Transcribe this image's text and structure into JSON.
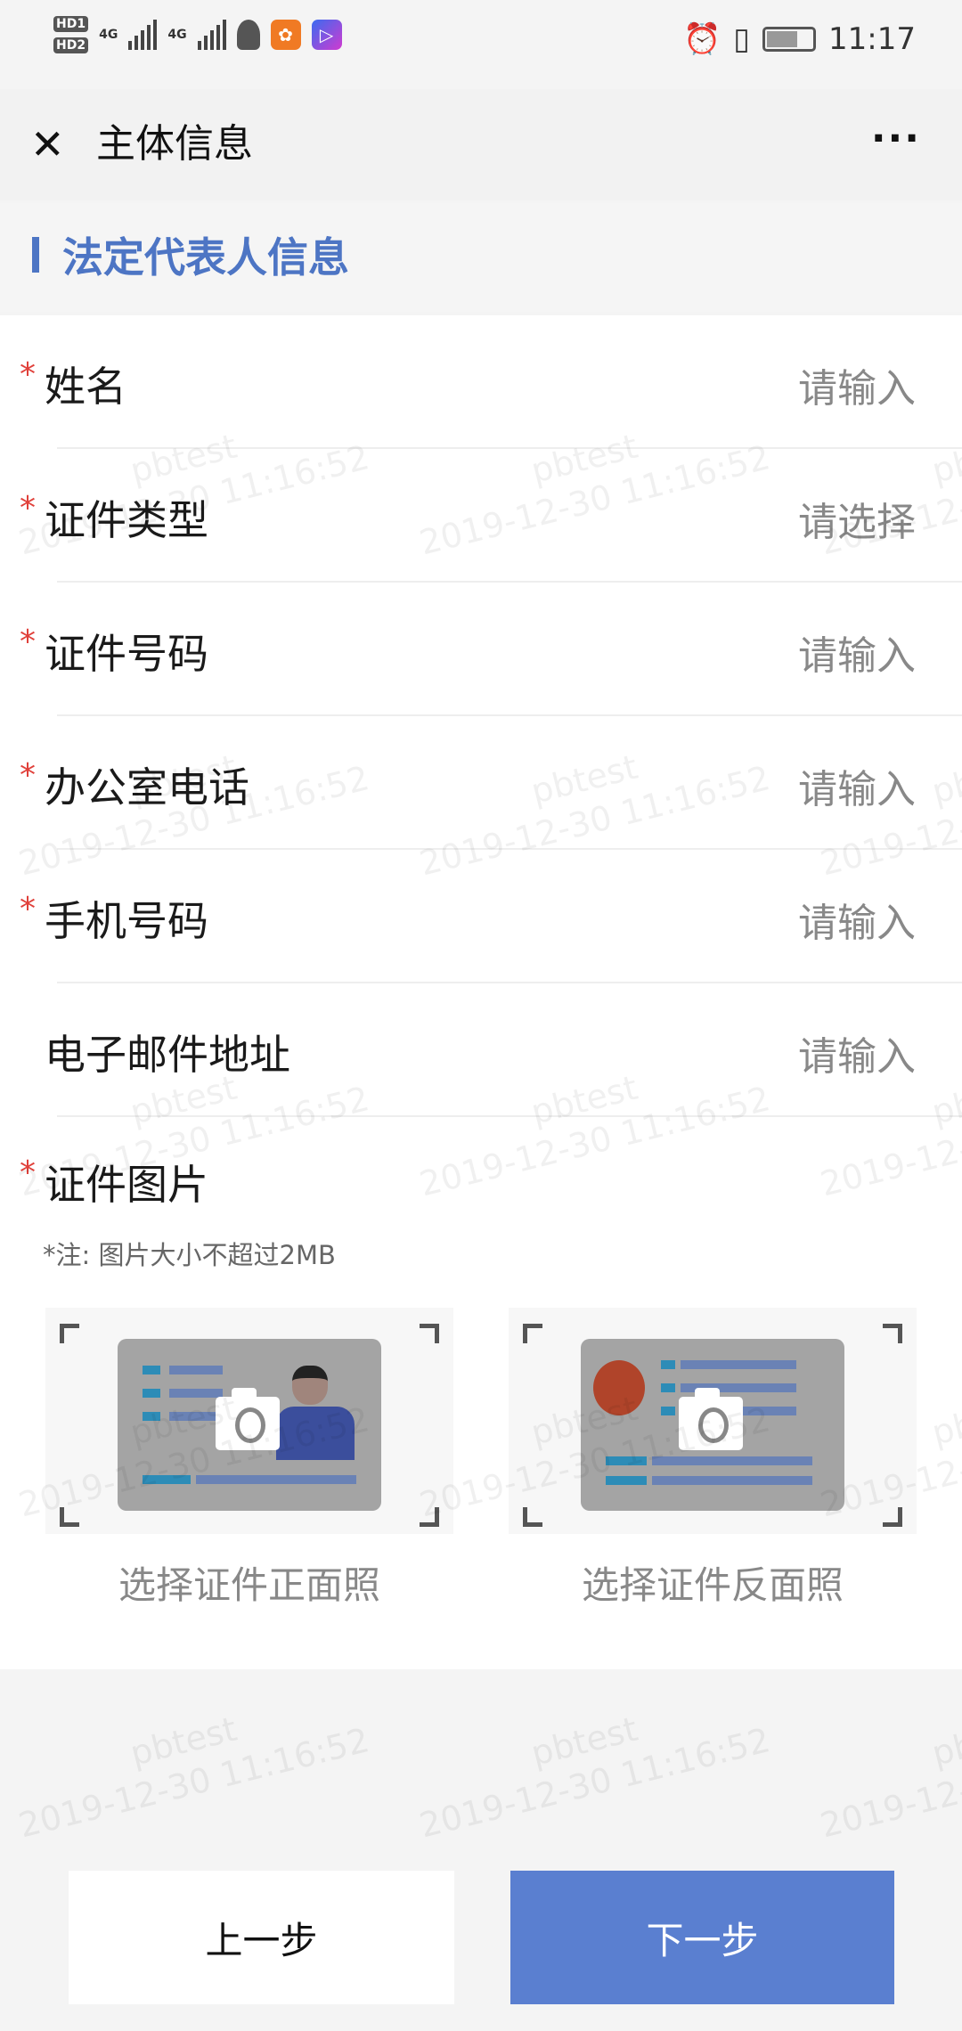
{
  "status_bar": {
    "time": "11:17",
    "sim1": "HD1",
    "sim2": "HD2",
    "network1": "4G",
    "network2": "4G"
  },
  "nav": {
    "title": "主体信息",
    "more": "···"
  },
  "section": {
    "title": "法定代表人信息"
  },
  "fields": [
    {
      "label": "姓名",
      "required": true,
      "placeholder": "请输入"
    },
    {
      "label": "证件类型",
      "required": true,
      "placeholder": "请选择"
    },
    {
      "label": "证件号码",
      "required": true,
      "placeholder": "请输入"
    },
    {
      "label": "办公室电话",
      "required": true,
      "placeholder": "请输入"
    },
    {
      "label": "手机号码",
      "required": true,
      "placeholder": "请输入"
    },
    {
      "label": "电子邮件地址",
      "required": false,
      "placeholder": "请输入"
    }
  ],
  "id_images": {
    "label": "证件图片",
    "required": true,
    "note": "*注: 图片大小不超过2MB",
    "front_caption": "选择证件正面照",
    "back_caption": "选择证件反面照"
  },
  "buttons": {
    "prev": "上一步",
    "next": "下一步"
  },
  "watermark": {
    "line1": "pbtest",
    "line2": "2019-12-30 11:16:52"
  },
  "colors": {
    "accent": "#4d75c4",
    "next_button": "#5a7fd0",
    "required": "#e0403a"
  }
}
